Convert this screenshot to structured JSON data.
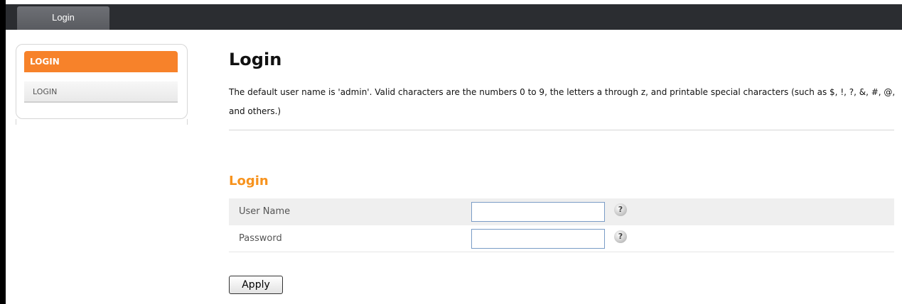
{
  "topbar": {
    "tab_label": "Login"
  },
  "sidebar": {
    "header": "LOGIN",
    "items": [
      {
        "label": "LOGIN"
      }
    ]
  },
  "main": {
    "title": "Login",
    "description": "The default user name is 'admin'. Valid characters are the numbers 0 to 9, the letters a through z, and printable special characters (such as $, !, ?, &, #, @, and others.)",
    "section_title": "Login",
    "fields": [
      {
        "label": "User Name",
        "value": "",
        "help": "?"
      },
      {
        "label": "Password",
        "value": "",
        "help": "?"
      }
    ],
    "apply_label": "Apply"
  },
  "colors": {
    "accent_orange": "#f7822a",
    "section_title": "#f7931e",
    "topbar": "#2b2d31"
  },
  "icons": {
    "help": "question-mark-icon"
  }
}
